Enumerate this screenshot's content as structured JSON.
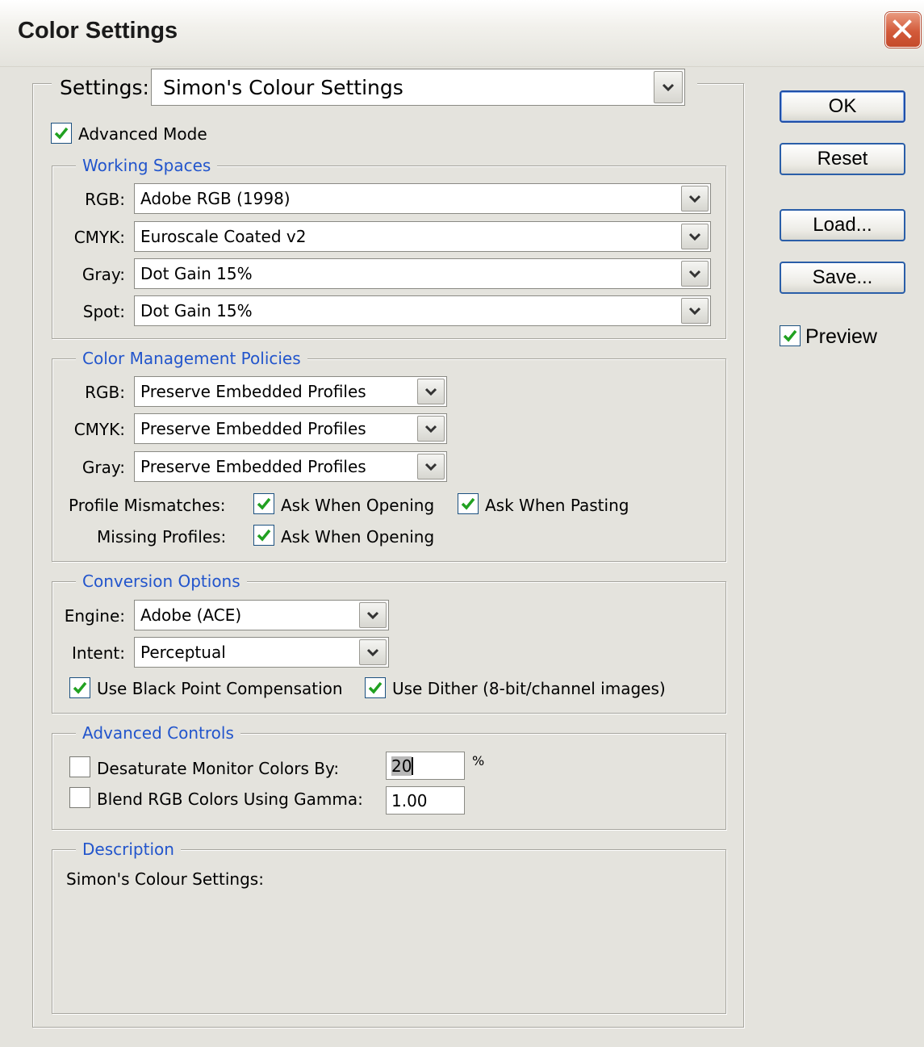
{
  "window": {
    "title": "Color Settings"
  },
  "settings": {
    "label": "Settings:",
    "value": "Simon's Colour Settings"
  },
  "advanced_mode": {
    "label": "Advanced Mode",
    "checked": true
  },
  "working_spaces": {
    "legend": "Working Spaces",
    "rgb": {
      "label": "RGB:",
      "value": "Adobe RGB (1998)"
    },
    "cmyk": {
      "label": "CMYK:",
      "value": "Euroscale Coated v2"
    },
    "gray": {
      "label": "Gray:",
      "value": "Dot Gain 15%"
    },
    "spot": {
      "label": "Spot:",
      "value": "Dot Gain 15%"
    }
  },
  "policies": {
    "legend": "Color Management Policies",
    "rgb": {
      "label": "RGB:",
      "value": "Preserve Embedded Profiles"
    },
    "cmyk": {
      "label": "CMYK:",
      "value": "Preserve Embedded Profiles"
    },
    "gray": {
      "label": "Gray:",
      "value": "Preserve Embedded Profiles"
    },
    "profile_mismatches": {
      "label": "Profile Mismatches:",
      "ask_opening": "Ask When Opening",
      "ask_pasting": "Ask When Pasting"
    },
    "missing_profiles": {
      "label": "Missing Profiles:",
      "ask_opening": "Ask When Opening"
    }
  },
  "conversion": {
    "legend": "Conversion Options",
    "engine": {
      "label": "Engine:",
      "value": "Adobe (ACE)"
    },
    "intent": {
      "label": "Intent:",
      "value": "Perceptual"
    },
    "black_point": "Use Black Point Compensation",
    "dither": "Use Dither (8-bit/channel images)"
  },
  "advanced_controls": {
    "legend": "Advanced Controls",
    "desaturate": {
      "label": "Desaturate Monitor Colors By:",
      "value": "20",
      "unit": "%",
      "checked": false
    },
    "blend": {
      "label": "Blend RGB Colors Using Gamma:",
      "value": "1.00",
      "checked": false
    }
  },
  "description": {
    "legend": "Description",
    "text": "Simon's Colour Settings:"
  },
  "buttons": {
    "ok": "OK",
    "reset": "Reset",
    "load": "Load...",
    "save": "Save..."
  },
  "preview": {
    "label": "Preview",
    "checked": true
  },
  "colors": {
    "legend_blue": "#2255cc",
    "check_green": "#21a121",
    "close_red": "#d35a3a"
  }
}
